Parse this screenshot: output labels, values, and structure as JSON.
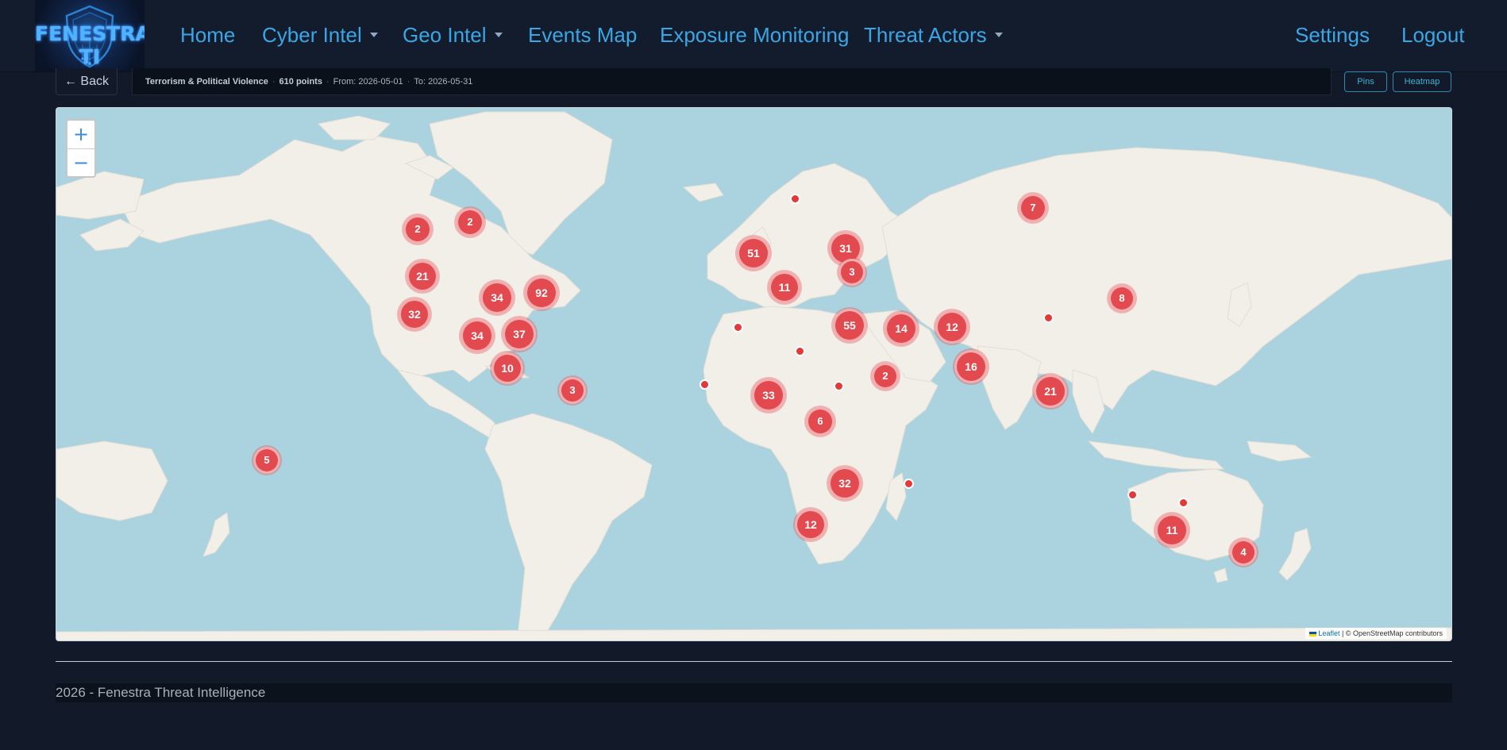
{
  "brand": {
    "logo_text": "FENESTRA TI"
  },
  "nav": {
    "home": "Home",
    "cyber_intel": "Cyber Intel",
    "geo_intel": "Geo Intel",
    "events_map": "Events Map",
    "exposure_monitoring": "Exposure Monitoring",
    "threat_actors": "Threat Actors",
    "settings": "Settings",
    "logout": "Logout"
  },
  "toolbar": {
    "back_label": "← Back",
    "category": "Terrorism & Political Violence",
    "points": "610 points",
    "from": "From: 2026-05-01",
    "to": "To: 2026-05-31",
    "separator": "·",
    "pins_label": "Pins",
    "heatmap_label": "Heatmap"
  },
  "map": {
    "zoom_in": "+",
    "zoom_out": "−",
    "attribution_leaflet": "Leaflet",
    "attribution_rest": "| © OpenStreetMap contributors",
    "colors": {
      "water": "#aad3df",
      "land": "#f2efe9",
      "cluster": "#e34a4f"
    },
    "clusters": [
      {
        "count": "2"
      },
      {
        "count": "2"
      },
      {
        "count": "21"
      },
      {
        "count": "32"
      },
      {
        "count": "34"
      },
      {
        "count": "92"
      },
      {
        "count": "34"
      },
      {
        "count": "37"
      },
      {
        "count": "10"
      },
      {
        "count": "3"
      },
      {
        "count": "5"
      },
      {
        "count": "51"
      },
      {
        "count": "11"
      },
      {
        "count": "31"
      },
      {
        "count": "3"
      },
      {
        "count": "55"
      },
      {
        "count": "14"
      },
      {
        "count": "12"
      },
      {
        "count": "16"
      },
      {
        "count": "2"
      },
      {
        "count": "33"
      },
      {
        "count": "6"
      },
      {
        "count": "32"
      },
      {
        "count": "12"
      },
      {
        "count": "7"
      },
      {
        "count": "8"
      },
      {
        "count": "21"
      },
      {
        "count": "11"
      },
      {
        "count": "4"
      }
    ]
  },
  "footer": {
    "text": "2026 - Fenestra Threat Intelligence"
  }
}
